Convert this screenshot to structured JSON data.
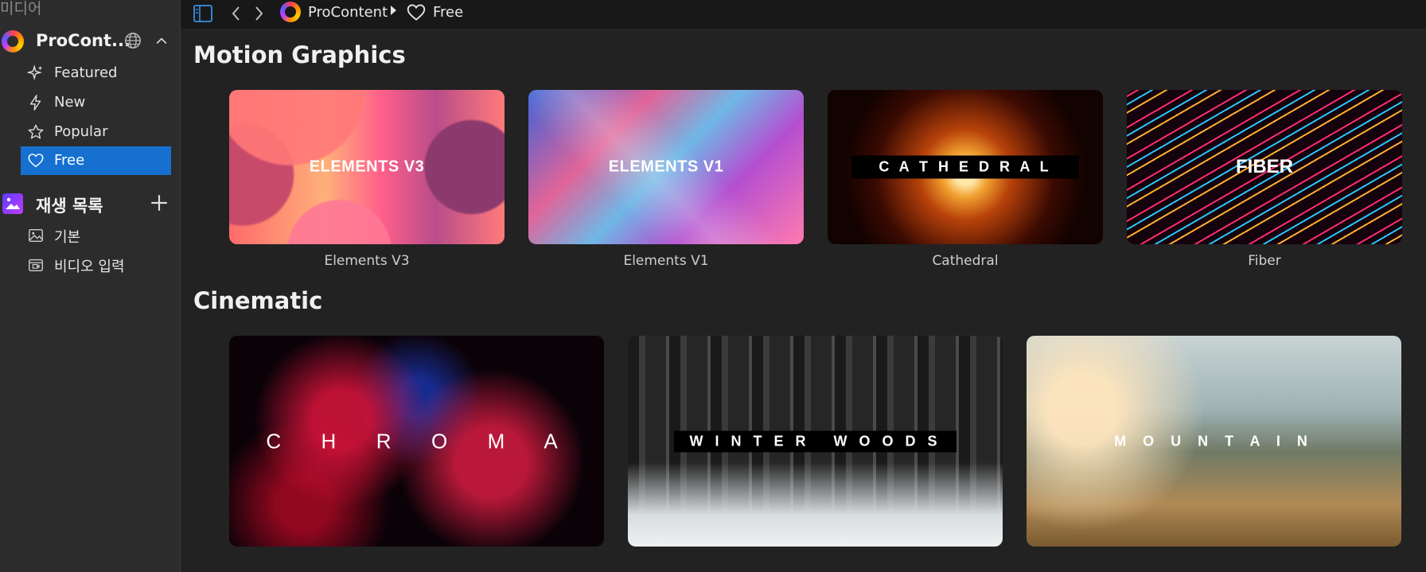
{
  "sidebar": {
    "header": "미디어",
    "source": {
      "title": "ProCont..."
    },
    "nav": [
      {
        "label": "Featured",
        "icon": "sparkle-icon"
      },
      {
        "label": "New",
        "icon": "bolt-icon"
      },
      {
        "label": "Popular",
        "icon": "star-icon"
      },
      {
        "label": "Free",
        "icon": "heart-icon",
        "active": true
      }
    ],
    "playlist": {
      "title": "재생 목록",
      "items": [
        {
          "label": "기본",
          "icon": "image-icon"
        },
        {
          "label": "비디오 입력",
          "icon": "video-input-icon"
        }
      ]
    }
  },
  "topbar": {
    "breadcrumb": {
      "root": "ProContent",
      "current": "Free"
    }
  },
  "sections": [
    {
      "title": "Motion Graphics",
      "cards": [
        {
          "overlay": "ELEMENTS V3",
          "caption": "Elements V3"
        },
        {
          "overlay": "ELEMENTS V1",
          "caption": "Elements V1"
        },
        {
          "overlay": "C A T H E D R A L",
          "caption": "Cathedral"
        },
        {
          "overlay": "FIBER",
          "caption": "Fiber"
        }
      ]
    },
    {
      "title": "Cinematic",
      "cards": [
        {
          "overlay": "C  H  R  O  M  A"
        },
        {
          "overlay": "W I N T E R   W O O D S"
        },
        {
          "overlay": "M O U N T A I N"
        }
      ]
    }
  ],
  "colors": {
    "accent": "#1670d0",
    "background": "#222222",
    "sidebar": "#2c2c2c",
    "topbar": "#181818"
  }
}
